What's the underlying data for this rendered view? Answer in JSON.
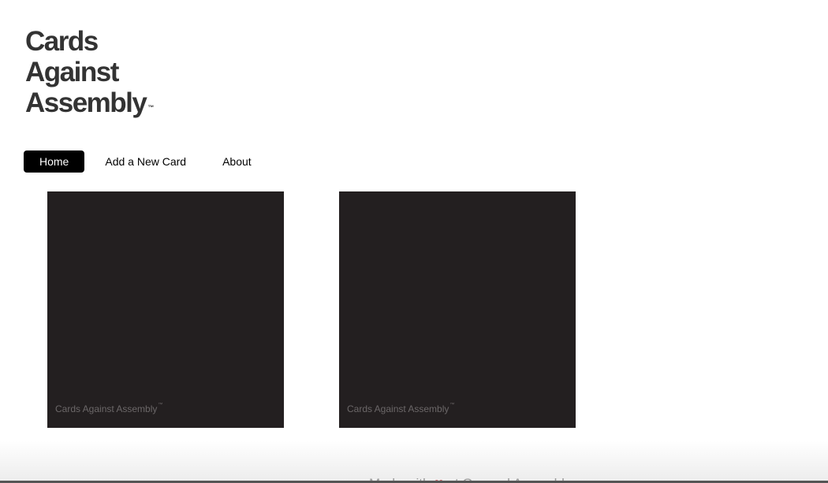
{
  "logo": {
    "line1": "Cards",
    "line2": "Against",
    "line3": "Assembly",
    "trademark": "™"
  },
  "nav": {
    "items": [
      {
        "label": "Home",
        "active": true
      },
      {
        "label": "Add a New Card",
        "active": false
      },
      {
        "label": "About",
        "active": false
      }
    ]
  },
  "cards": [
    {
      "footer": "Cards Against Assembly",
      "trademark": "™"
    },
    {
      "footer": "Cards Against Assembly",
      "trademark": "™"
    }
  ],
  "footer": {
    "prefix": "Made with",
    "icon": "heart-icon",
    "suffix": "at General Assembly"
  },
  "colors": {
    "card_background": "#231f20",
    "nav_active_background": "#000000",
    "heart": "#c0141b"
  }
}
